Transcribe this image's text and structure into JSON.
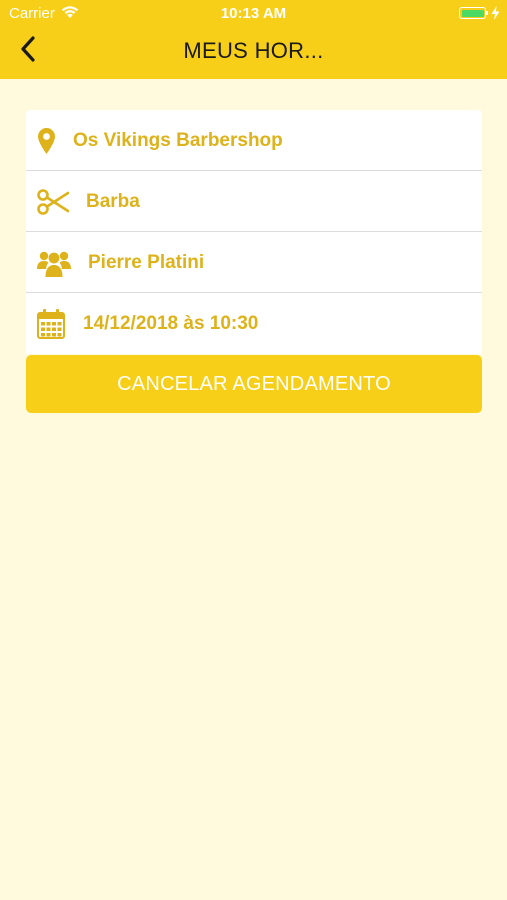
{
  "status_bar": {
    "carrier": "Carrier",
    "time": "10:13 AM",
    "battery_color": "#4CD964"
  },
  "nav": {
    "title": "MEUS HOR...",
    "back_icon": "chevron-left-icon"
  },
  "appointment": {
    "location": {
      "icon": "map-pin-icon",
      "text": "Os Vikings Barbershop"
    },
    "service": {
      "icon": "scissors-icon",
      "text": "Barba"
    },
    "professional": {
      "icon": "users-icon",
      "text": "Pierre Platini"
    },
    "datetime": {
      "icon": "calendar-icon",
      "text": "14/12/2018 às 10:30"
    }
  },
  "actions": {
    "cancel_label": "CANCELAR AGENDAMENTO"
  },
  "colors": {
    "accent": "#F7CF18",
    "accent_text": "#DDB21A",
    "background": "#FFFADE",
    "card": "#FFFFFF"
  }
}
